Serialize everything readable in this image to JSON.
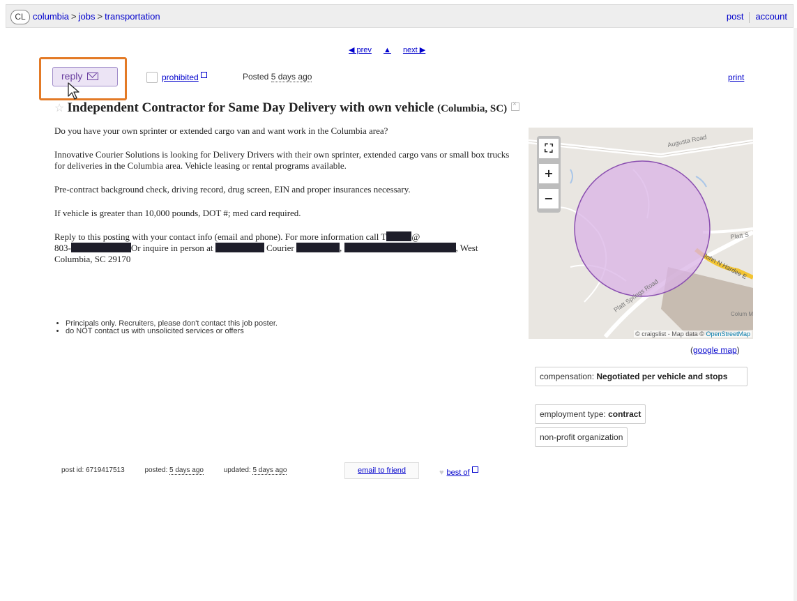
{
  "topbar": {
    "logo": "CL",
    "breadcrumbs": [
      "columbia",
      "jobs",
      "transportation"
    ],
    "separator": ">",
    "post_link": "post",
    "account_link": "account"
  },
  "nav": {
    "prev": "◀ prev",
    "up": "▲",
    "next": "next ▶"
  },
  "actions": {
    "reply_label": "reply",
    "prohibited_label": "prohibited",
    "posted_prefix": "Posted",
    "posted_value": "5 days ago",
    "print_label": "print"
  },
  "posting": {
    "title": "Independent Contractor for Same Day Delivery with own vehicle",
    "location": "(Columbia, SC)",
    "p1": "Do you have your own sprinter or extended cargo van and want work in the Columbia area?",
    "p2": "Innovative Courier Solutions is looking for Delivery Drivers with their own sprinter, extended cargo vans or small box trucks for deliveries in the Columbia area. Vehicle leasing or rental programs available.",
    "p3": "Pre-contract background check, driving record, drug screen, EIN and proper insurances necessary.",
    "p4": "If vehicle is greater than 10,000 pounds, DOT #; med card required.",
    "p5_a": "Reply to this posting with your contact info (email and phone). For more information call T",
    "p5_b": "@",
    "p5_c": "803-",
    "p5_d": "Or inquire in person at",
    "p5_e": "Courier",
    "p5_f": ", West",
    "p5_g": "Columbia, SC 29170",
    "notices": [
      "Principals only. Recruiters, please don't contact this job poster.",
      "do NOT contact us with unsolicited services or offers"
    ]
  },
  "map": {
    "credit_prefix": "© craigslist - Map data ©",
    "credit_osm": "OpenStreetMap",
    "google_map_open": "(",
    "google_map_link": "google map",
    "google_map_close": ")",
    "labels": [
      "Augusta Road",
      "Platt Springs Road",
      "John N Hardee E",
      "Platt S",
      "Colum Metrop"
    ]
  },
  "attributes": {
    "compensation_label": "compensation:",
    "compensation_value": "Negotiated per vehicle and stops",
    "employment_label": "employment type:",
    "employment_value": "contract",
    "nonprofit": "non-profit organization"
  },
  "footer": {
    "post_id_label": "post id:",
    "post_id": "6719417513",
    "posted_label": "posted:",
    "posted_value": "5 days ago",
    "updated_label": "updated:",
    "updated_value": "5 days ago",
    "email_to_friend": "email to friend",
    "best_of": "best of"
  },
  "colors": {
    "highlight": "#e37a26",
    "reply_bg": "#ece4f5",
    "map_circle": "#d9b3e6",
    "link": "#0000cc"
  }
}
